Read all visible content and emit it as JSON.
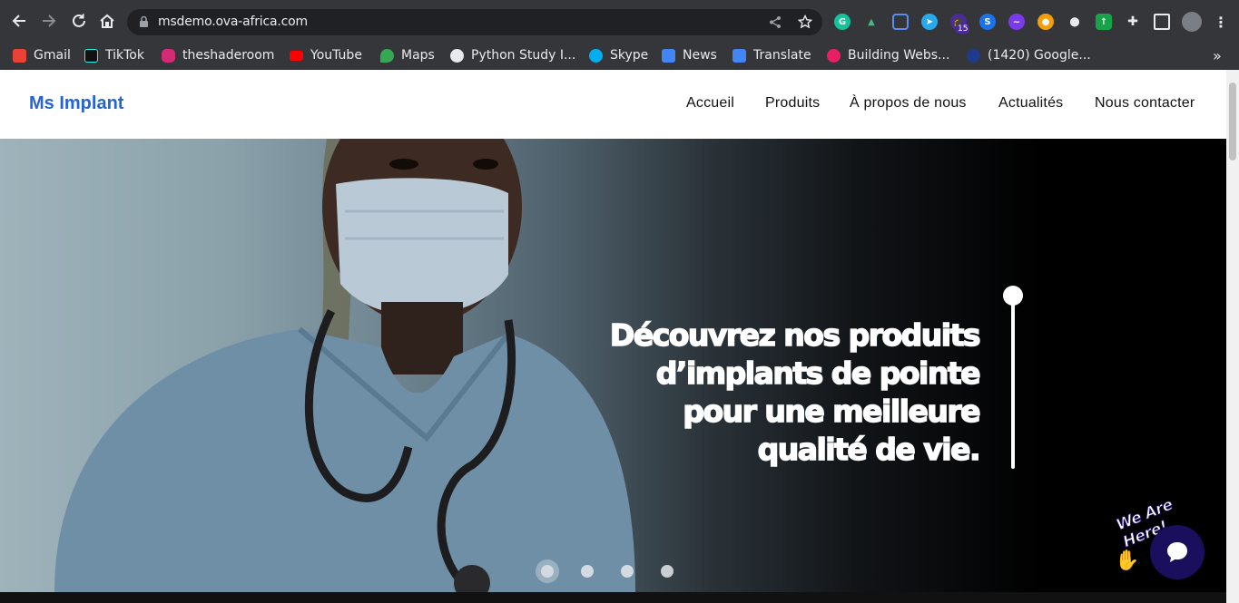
{
  "browser": {
    "url": "msdemo.ova-africa.com",
    "extension_badge": "15",
    "bookmarks": [
      {
        "label": "Gmail",
        "icon": "gmail-icon",
        "color": "#ea4335"
      },
      {
        "label": "TikTok",
        "icon": "tiktok-icon",
        "color": "#111111"
      },
      {
        "label": "theshaderoom",
        "icon": "instagram-icon",
        "color": "#d62976"
      },
      {
        "label": "YouTube",
        "icon": "youtube-icon",
        "color": "#ff0000"
      },
      {
        "label": "Maps",
        "icon": "maps-icon",
        "color": "#34a853"
      },
      {
        "label": "Python Study I...",
        "icon": "globe-icon",
        "color": "#e8eaed"
      },
      {
        "label": "Skype",
        "icon": "skype-icon",
        "color": "#00aff0"
      },
      {
        "label": "News",
        "icon": "news-icon",
        "color": "#4285f4"
      },
      {
        "label": "Translate",
        "icon": "translate-icon",
        "color": "#4285f4"
      },
      {
        "label": "Building Webs...",
        "icon": "building-icon",
        "color": "#e91e63"
      },
      {
        "label": "(1420) Google...",
        "icon": "google-icon",
        "color": "#4285f4"
      }
    ],
    "more_bookmarks": "»"
  },
  "site": {
    "logo": "Ms Implant",
    "nav": [
      "Accueil",
      "Produits",
      "À propos de nous",
      "Actualités",
      "Nous contacter"
    ],
    "hero": {
      "lines": [
        "Découvrez nos produits",
        "d’implants de pointe",
        "pour une meilleure",
        "qualité de vie."
      ]
    },
    "carousel_active": 1,
    "carousel_count": 4,
    "chat_badge": "We Are Here!",
    "accent_color": "#2563d8"
  }
}
